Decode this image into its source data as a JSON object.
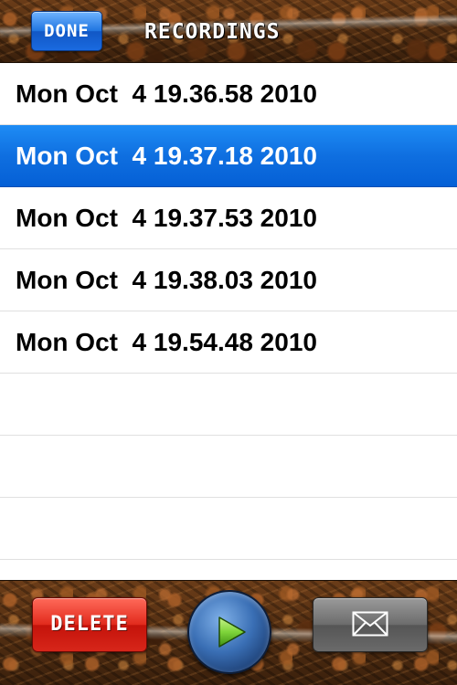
{
  "navbar": {
    "done_label": "DONE",
    "title": "RECORDINGS"
  },
  "recordings": [
    {
      "label": "Mon Oct  4 19.36.58 2010",
      "selected": false
    },
    {
      "label": "Mon Oct  4 19.37.18 2010",
      "selected": true
    },
    {
      "label": "Mon Oct  4 19.37.53 2010",
      "selected": false
    },
    {
      "label": "Mon Oct  4 19.38.03 2010",
      "selected": false
    },
    {
      "label": "Mon Oct  4 19.54.48 2010",
      "selected": false
    }
  ],
  "empty_rows": 3,
  "toolbar": {
    "delete_label": "DELETE",
    "play_icon": "play-icon",
    "mail_icon": "mail-icon"
  },
  "colors": {
    "selection_blue": "#0f6fe0",
    "done_blue": "#1f74e0",
    "delete_red": "#e12a1c",
    "play_green": "#7ed43a",
    "rust_brown": "#4a2a12"
  }
}
